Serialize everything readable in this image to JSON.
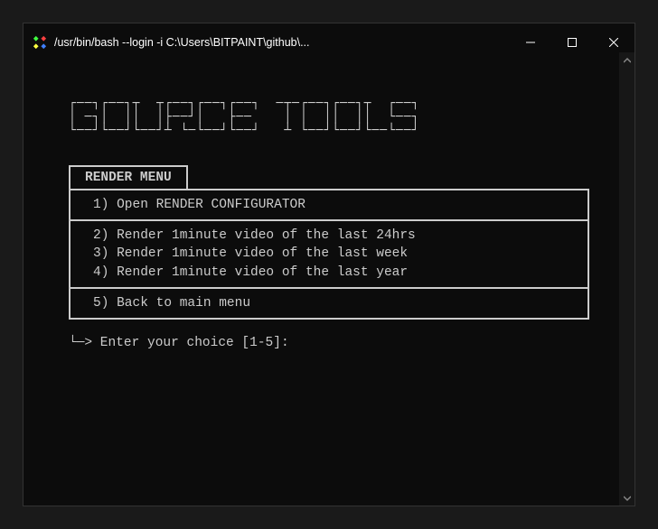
{
  "window": {
    "title": "/usr/bin/bash --login -i C:\\Users\\BITPAINT\\github\\..."
  },
  "app": {
    "title_ascii": " ___  ___           ___  ___   ___       _____ ___  ___       ___\n|    |   | |   |   |   ||    |           |   ||   ||   ||    |\n|___ |   | |   | __ |    |__             |   ||   ||   ||    |___\n|   ||   | |   ||   |    |               |   ||   ||   ||        |\n|___||___| |___||   |___ |___            |   ||___||___||___  ___|"
  },
  "menu": {
    "tab_label": "RENDER MENU",
    "sections": [
      {
        "items": [
          "1) Open RENDER CONFIGURATOR"
        ]
      },
      {
        "items": [
          "2) Render 1minute video of the last 24hrs",
          "3) Render 1minute video of the last week",
          "4) Render 1minute video of the last year"
        ]
      },
      {
        "items": [
          "5) Back to  main menu"
        ]
      }
    ]
  },
  "prompt": {
    "text": "└─> Enter your choice [1-5]:"
  }
}
